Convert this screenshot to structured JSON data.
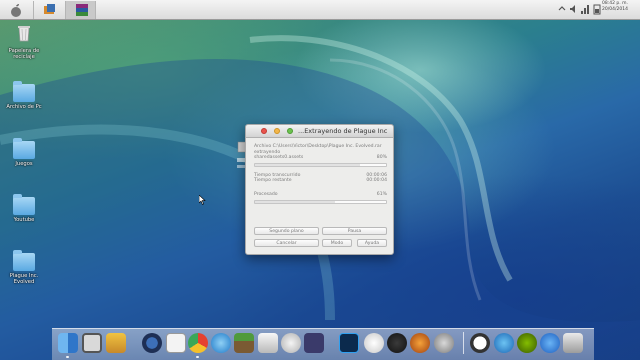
{
  "menubar": {
    "clock_time": "08:42 p. m.",
    "clock_date": "20/04/2014"
  },
  "desktop_icons": [
    {
      "label": "Papelera de reciclaje",
      "icon": "trash-icon"
    },
    {
      "label": "Archivo de Pc",
      "icon": "folder-icon"
    },
    {
      "label": "Juegos",
      "icon": "folder-icon"
    },
    {
      "label": "Youtube",
      "icon": "folder-icon"
    },
    {
      "label": "Plague Inc. Evolved",
      "icon": "folder-icon"
    }
  ],
  "dialog": {
    "title": "...Extrayendo de Plague Inc",
    "archive_line1": "Archivo C:\\Users\\Victor\\Desktop\\Plague Inc. Evolved.rar",
    "archive_line2": "extrayendo",
    "current_file": "sharedassets0.assets",
    "file_percent": "80%",
    "file_progress": 0.8,
    "elapsed_label": "Tiempo transcurrido",
    "elapsed_value": "00:00:06",
    "remaining_label": "Tiempo restante",
    "remaining_value": "00:00:04",
    "processed_label": "Procesado",
    "processed_percent": "61%",
    "processed_progress": 0.61,
    "buttons": {
      "background": "Segundo plano",
      "pause": "Pausa",
      "cancel": "Cancelar",
      "mode": "Modo",
      "help": "Ayuda"
    }
  },
  "dock": {
    "apps": [
      "finder-icon",
      "ccleaner-icon",
      "folder-tools-icon",
      "quicktime-icon",
      "textedit-icon",
      "chrome-icon",
      "safari-icon",
      "minecraft-icon",
      "printer-icon",
      "x-icon",
      "after-effects-icon",
      "photoshop-icon",
      "cloud-icon",
      "power-icon",
      "firefox-icon",
      "launch-icon",
      "clock-icon",
      "itunes-icon",
      "spotify-icon",
      "app-store-icon",
      "trash-icon"
    ]
  }
}
